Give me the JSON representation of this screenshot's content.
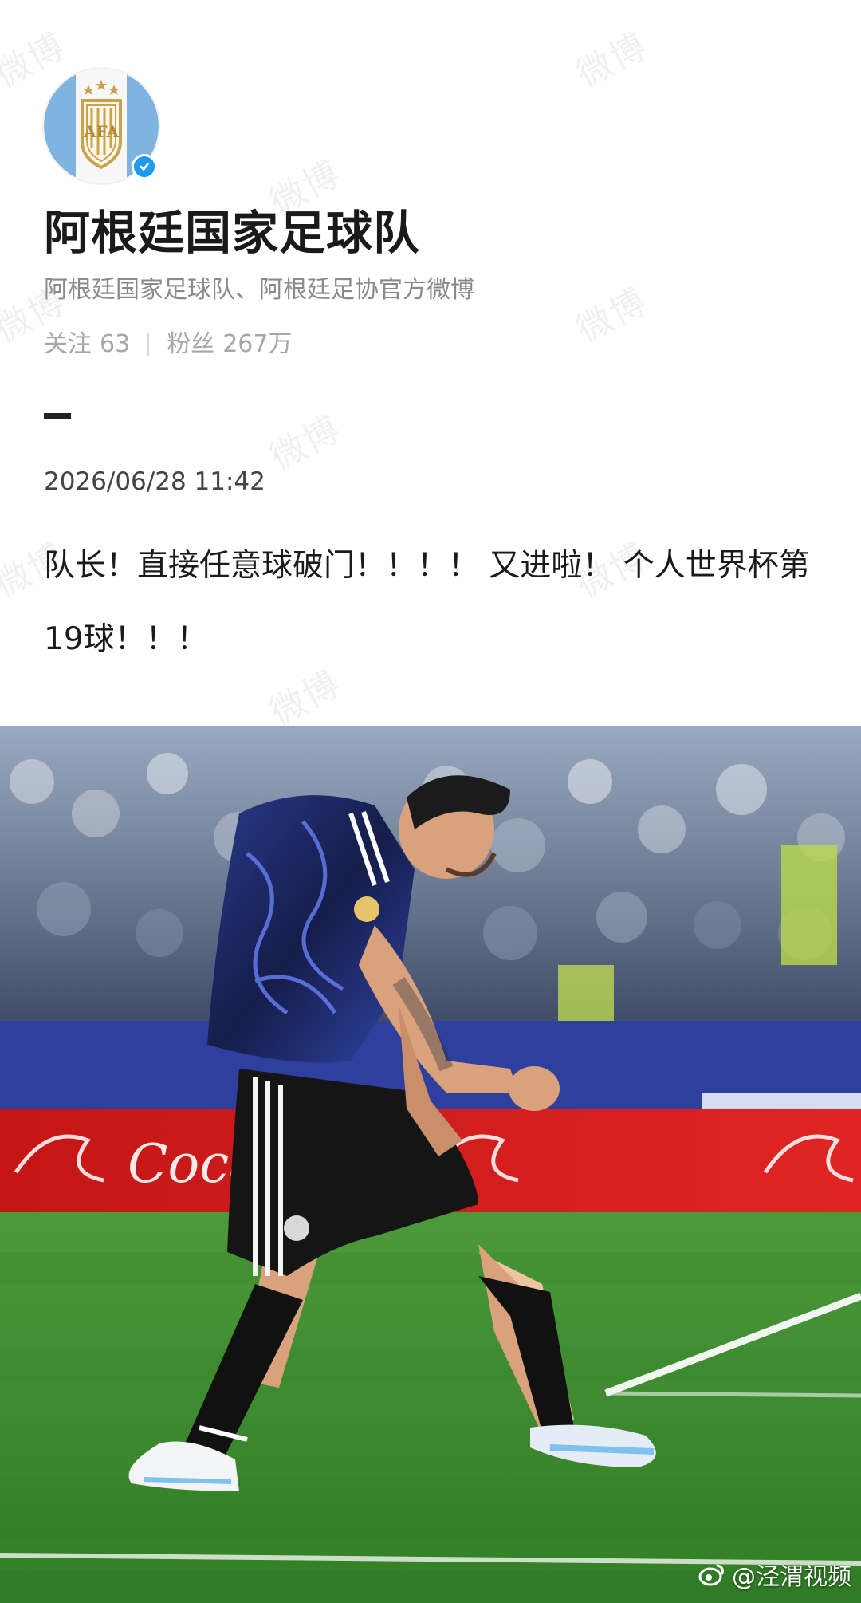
{
  "watermark_text": "微博",
  "profile": {
    "avatar_label": "AFA",
    "name": "阿根廷国家足球队",
    "bio": "阿根廷国家足球队、阿根廷足协官方微博",
    "following_label": "关注",
    "following_count": "63",
    "followers_label": "粉丝",
    "followers_count": "267万",
    "verified": true
  },
  "post": {
    "timestamp": "2026/06/28 11:42",
    "text": "队长！直接任意球破门！！！！ 又进啦！ 个人世界杯第19球！！！"
  },
  "photo": {
    "source_tag": "@泾渭视频",
    "ad_board_text": "Coca-Cola"
  },
  "colors": {
    "verified": "#1f98f0",
    "ad_board": "#d21a1a",
    "pitch": "#3e8d2e",
    "jersey": "#1a2452"
  },
  "icons": {
    "verified": "check-icon",
    "source": "weibo-icon"
  }
}
